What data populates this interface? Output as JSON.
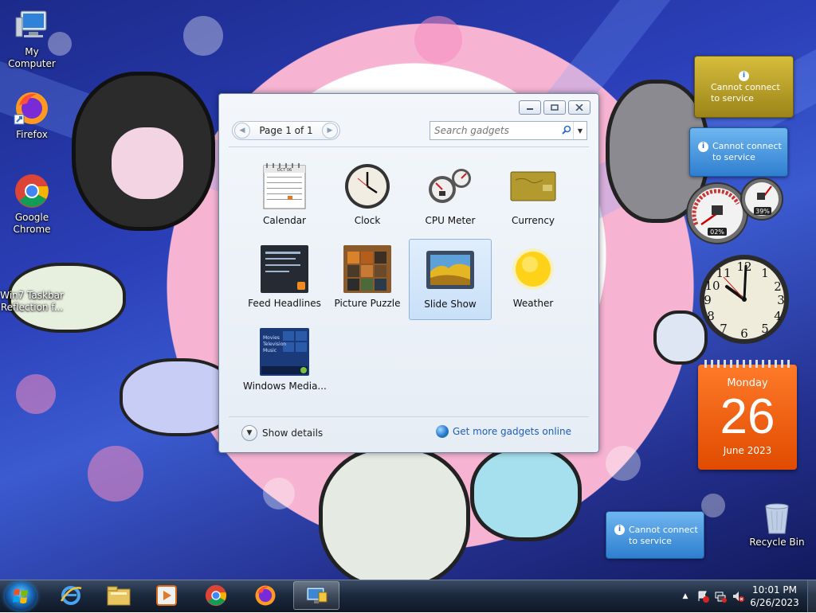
{
  "desktop": {
    "icons": [
      {
        "label": "My Computer",
        "icon": "computer-icon"
      },
      {
        "label": "Firefox",
        "icon": "firefox-icon"
      },
      {
        "label": "Google Chrome",
        "icon": "chrome-icon"
      },
      {
        "label": "Win7 Taskbar Reflection f...",
        "icon": "app-shortcut-icon"
      },
      {
        "label": "Recycle Bin",
        "icon": "recycle-bin-icon"
      }
    ]
  },
  "gadget_window": {
    "pager": "Page 1 of 1",
    "search_placeholder": "Search gadgets",
    "gadgets": [
      {
        "label": "Calendar",
        "selected": false
      },
      {
        "label": "Clock",
        "selected": false
      },
      {
        "label": "CPU Meter",
        "selected": false
      },
      {
        "label": "Currency",
        "selected": false
      },
      {
        "label": "Feed Headlines",
        "selected": false
      },
      {
        "label": "Picture Puzzle",
        "selected": false
      },
      {
        "label": "Slide Show",
        "selected": true
      },
      {
        "label": "Weather",
        "selected": false
      },
      {
        "label": "Windows Media...",
        "selected": false
      }
    ],
    "calendar_thumb_month": "OCT 06",
    "media_thumb_lines": [
      "Movies",
      "Television",
      "Music"
    ],
    "show_details": "Show details",
    "more_online": "Get more gadgets online"
  },
  "sidebar": {
    "service_error": "Cannot connect to service",
    "service_error_lines": [
      "Cannot connect",
      "to service"
    ],
    "cpu_percent": "02%",
    "memory_percent": "39%",
    "calendar": {
      "weekday": "Monday",
      "day": "26",
      "month_year": "June 2023"
    }
  },
  "taskbar": {
    "time": "10:01 PM",
    "date": "6/26/2023",
    "apps": [
      "internet-explorer-icon",
      "file-explorer-icon",
      "media-player-icon",
      "chrome-icon",
      "firefox-icon",
      "gadgets-icon"
    ]
  }
}
